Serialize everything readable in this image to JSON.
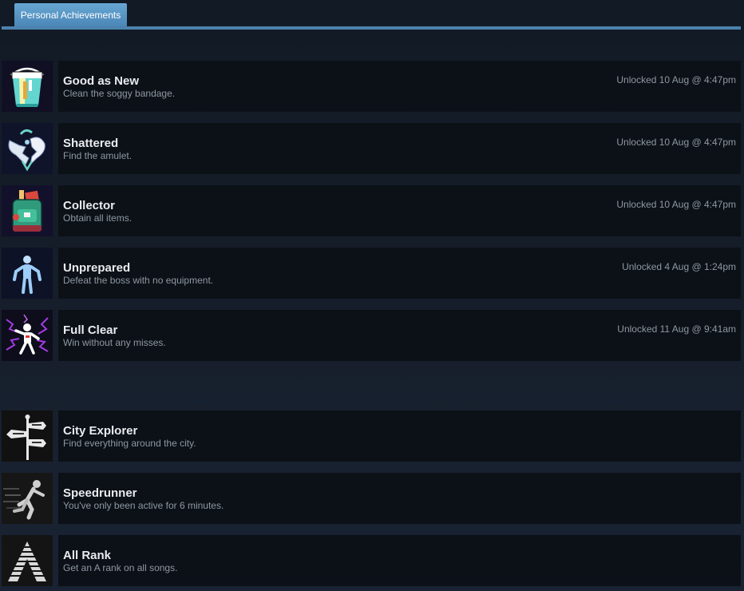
{
  "tab": {
    "label": "Personal Achievements"
  },
  "unlocked": [
    {
      "title": "Good as New",
      "description": "Clean the soggy bandage.",
      "unlocked": "Unlocked 10 Aug @ 4:47pm",
      "icon": "bucket-icon"
    },
    {
      "title": "Shattered",
      "description": "Find the amulet.",
      "unlocked": "Unlocked 10 Aug @ 4:47pm",
      "icon": "broken-heart-amulet-icon"
    },
    {
      "title": "Collector",
      "description": "Obtain all items.",
      "unlocked": "Unlocked 10 Aug @ 4:47pm",
      "icon": "backpack-icon"
    },
    {
      "title": "Unprepared",
      "description": "Defeat the boss with no equipment.",
      "unlocked": "Unlocked 4 Aug @ 1:24pm",
      "icon": "shrugging-figure-icon"
    },
    {
      "title": "Full Clear",
      "description": "Win without any misses.",
      "unlocked": "Unlocked 11 Aug @ 9:41am",
      "icon": "electrified-figure-icon"
    }
  ],
  "locked": [
    {
      "title": "City Explorer",
      "description": "Find everything around the city.",
      "icon": "signpost-icon"
    },
    {
      "title": "Speedrunner",
      "description": "You've only been active for 6 minutes.",
      "icon": "running-figure-icon"
    },
    {
      "title": "All Rank",
      "description": "Get an A rank on all songs.",
      "icon": "letter-a-rank-icon"
    }
  ]
}
